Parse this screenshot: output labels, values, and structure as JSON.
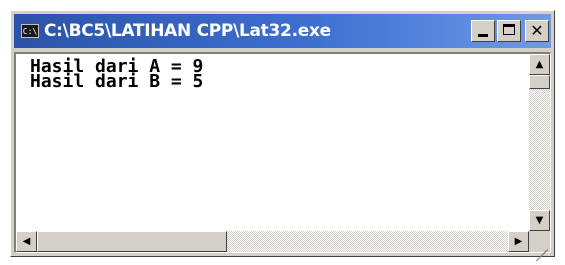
{
  "window": {
    "title": "C:\\BC5\\LATIHAN CPP\\Lat32.exe",
    "icon": "console-app-icon",
    "icon_text": "C:\\",
    "controls": [
      "minimize",
      "maximize",
      "close"
    ],
    "close_glyph": "✕"
  },
  "console": {
    "lines": [
      "Hasil dari A = 9",
      "Hasil dari B = 5"
    ]
  },
  "scrollbars": {
    "up_arrow": "▲",
    "down_arrow": "▼",
    "left_arrow": "◀",
    "right_arrow": "▶"
  }
}
